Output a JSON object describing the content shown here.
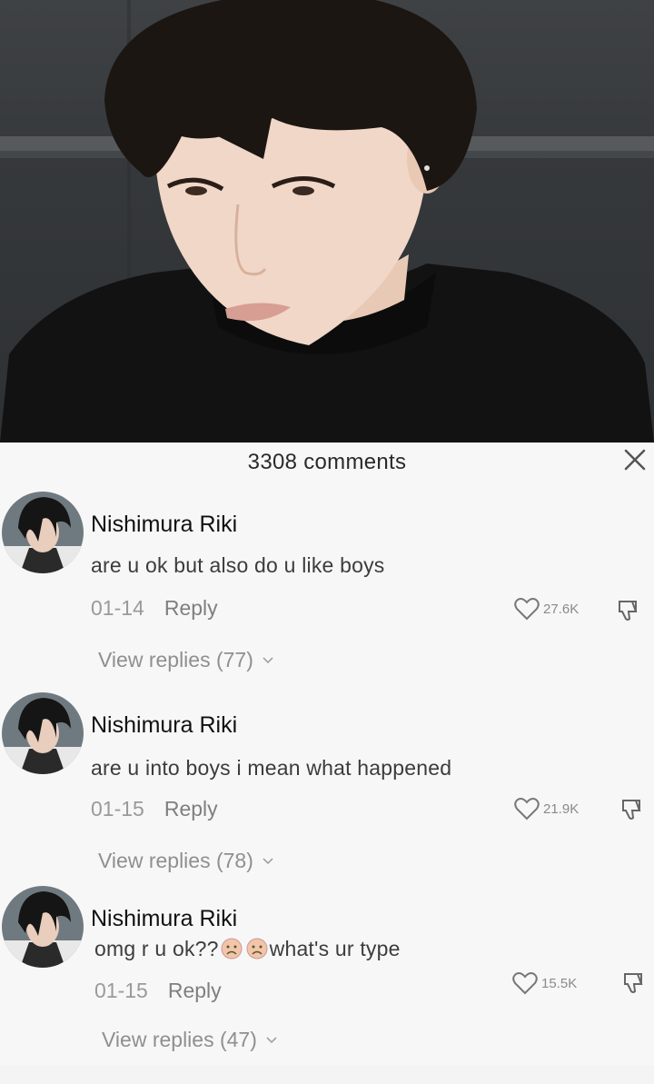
{
  "comments_header": {
    "count_label": "3308 comments"
  },
  "comments": [
    {
      "username": "Nishimura Riki",
      "text": "are u ok but also do u like boys",
      "date": "01-14",
      "reply_label": "Reply",
      "likes": "27.6K",
      "view_replies": "View replies (77)"
    },
    {
      "username": "Nishimura Riki",
      "text": "are u into boys i mean what happened",
      "date": "01-15",
      "reply_label": "Reply",
      "likes": "21.9K",
      "view_replies": "View replies (78)"
    },
    {
      "username": "Nishimura Riki",
      "text_before": "omg r u ok??",
      "text_after": "what's ur type",
      "emoji": [
        "sad-face-emoji",
        "sad-face-emoji"
      ],
      "date": "01-15",
      "reply_label": "Reply",
      "likes": "15.5K",
      "view_replies": "View replies (47)"
    }
  ],
  "icons": {
    "close": "close-icon",
    "like": "heart-icon",
    "dislike": "thumbs-down-icon",
    "expand": "chevron-down-icon"
  },
  "colors": {
    "panel_bg": "#f7f7f7",
    "username": "#111111",
    "meta_text": "#9a9a9a",
    "video_bg": "#35383b"
  }
}
